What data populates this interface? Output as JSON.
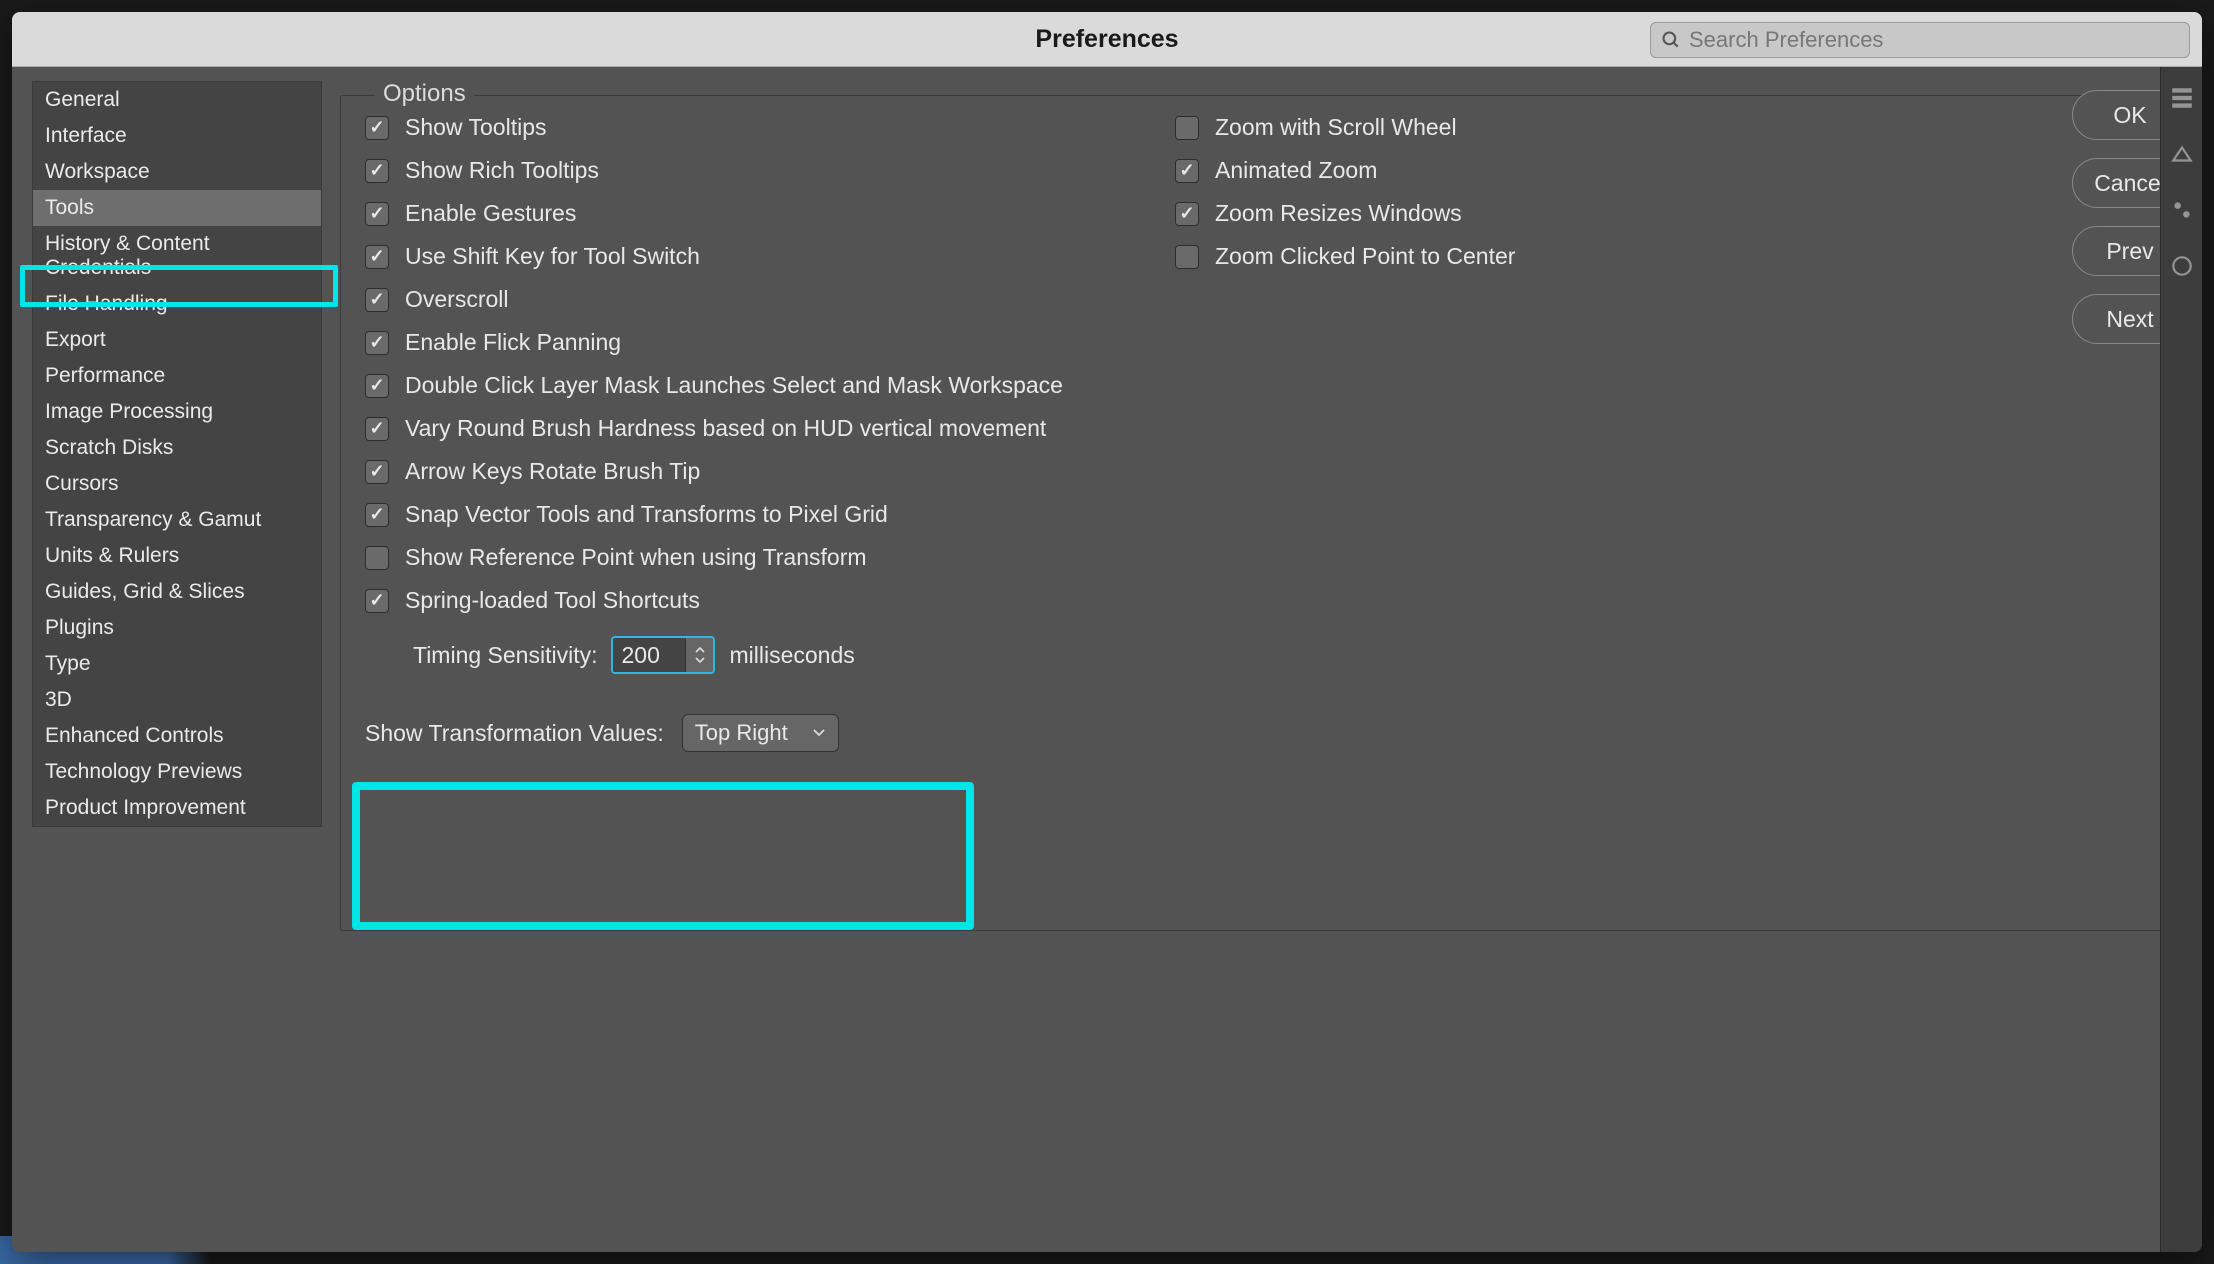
{
  "title": "Preferences",
  "search": {
    "placeholder": "Search Preferences"
  },
  "sidebar": {
    "items": [
      {
        "label": "General"
      },
      {
        "label": "Interface"
      },
      {
        "label": "Workspace"
      },
      {
        "label": "Tools"
      },
      {
        "label": "History & Content Credentials"
      },
      {
        "label": "File Handling"
      },
      {
        "label": "Export"
      },
      {
        "label": "Performance"
      },
      {
        "label": "Image Processing"
      },
      {
        "label": "Scratch Disks"
      },
      {
        "label": "Cursors"
      },
      {
        "label": "Transparency & Gamut"
      },
      {
        "label": "Units & Rulers"
      },
      {
        "label": "Guides, Grid & Slices"
      },
      {
        "label": "Plugins"
      },
      {
        "label": "Type"
      },
      {
        "label": "3D"
      },
      {
        "label": "Enhanced Controls"
      },
      {
        "label": "Technology Previews"
      },
      {
        "label": "Product Improvement"
      }
    ],
    "selected_index": 3
  },
  "options": {
    "legend": "Options",
    "left": [
      {
        "label": "Show Tooltips",
        "checked": true
      },
      {
        "label": "Show Rich Tooltips",
        "checked": true
      },
      {
        "label": "Enable Gestures",
        "checked": true
      },
      {
        "label": "Use Shift Key for Tool Switch",
        "checked": true
      },
      {
        "label": "Overscroll",
        "checked": true
      },
      {
        "label": "Enable Flick Panning",
        "checked": true
      },
      {
        "label": "Double Click Layer Mask Launches Select and Mask Workspace",
        "checked": true
      },
      {
        "label": "Vary Round Brush Hardness based on HUD vertical movement",
        "checked": true
      },
      {
        "label": "Arrow Keys Rotate Brush Tip",
        "checked": true
      },
      {
        "label": "Snap Vector Tools and Transforms to Pixel Grid",
        "checked": true
      },
      {
        "label": "Show Reference Point when using Transform",
        "checked": false
      },
      {
        "label": "Spring-loaded Tool Shortcuts",
        "checked": true
      }
    ],
    "right": [
      {
        "label": "Zoom with Scroll Wheel",
        "checked": false
      },
      {
        "label": "Animated Zoom",
        "checked": true
      },
      {
        "label": "Zoom Resizes Windows",
        "checked": true
      },
      {
        "label": "Zoom Clicked Point to Center",
        "checked": false
      }
    ],
    "timing": {
      "label": "Timing Sensitivity:",
      "value": "200",
      "unit": "milliseconds"
    },
    "transform": {
      "label": "Show Transformation Values:",
      "value": "Top Right"
    }
  },
  "buttons": {
    "ok": "OK",
    "cancel": "Cancel",
    "prev": "Prev",
    "next": "Next"
  }
}
